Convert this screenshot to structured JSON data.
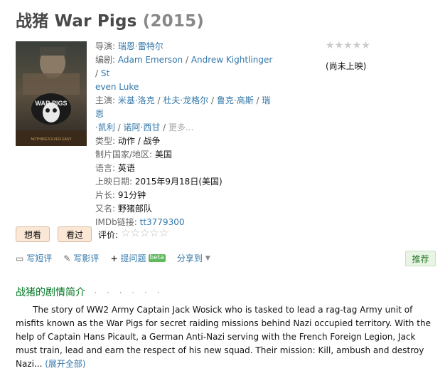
{
  "title": {
    "main": "战猪 War Pigs",
    "year": "(2015)"
  },
  "poster": {
    "badge_text": "WAR PIGS",
    "tagline": "NOTHING'S EVER EASY"
  },
  "info": {
    "director_label": "导演:",
    "director": "瑞恩·雷特尔",
    "writer_label": "编剧:",
    "writer_1": "Adam Emerson",
    "writer_2_line1": "Andrew Kightlinger",
    "writer_3_part1": "St",
    "writer_3_part2": "even Luke",
    "cast_label": "主演:",
    "cast_1": "米基·洛克",
    "cast_2": "杜夫·龙格尔",
    "cast_3": "鲁克·高斯",
    "cast_4_part1": "瑞恩",
    "cast_4_part2": "·凯利",
    "cast_5": "诺阿·西甘",
    "cast_more": "更多...",
    "genre_label": "类型:",
    "genre": "动作 / 战争",
    "country_label": "制片国家/地区:",
    "country": "美国",
    "language_label": "语言:",
    "language": "英语",
    "release_label": "上映日期:",
    "release": "2015年9月18日(美国)",
    "runtime_label": "片长:",
    "runtime": "91分钟",
    "aka_label": "又名:",
    "aka": "野猪部队",
    "imdb_label": "IMDb链接:",
    "imdb": "tt3779300"
  },
  "rating": {
    "status": "(尚未上映)"
  },
  "buttons": {
    "want": "想看",
    "seen": "看过",
    "rate_label": "评价:"
  },
  "actions": {
    "short_review": "写短评",
    "review": "写影评",
    "question": "提问题",
    "beta": "beta",
    "share": "分享到",
    "recommend": "推荐"
  },
  "synopsis": {
    "title": "战猪的剧情简介",
    "dots": "· · · · · ·",
    "text": "The story of WW2 Army Captain Jack Wosick who is tasked to lead a rag-tag Army unit of misfits known as the War Pigs for secret raiding missions behind Nazi occupied territory. With the help of Captain Hans Picault, a German Anti-Nazi serving with the French Foreign Legion, Jack must train, lead and earn the respect of his new squad. Their mission: Kill, ambush and destroy Nazi...",
    "expand": "(展开全部)"
  },
  "colors": {
    "link": "#3377aa",
    "section_green": "#007722",
    "button_bg": "#fbe7d6"
  }
}
